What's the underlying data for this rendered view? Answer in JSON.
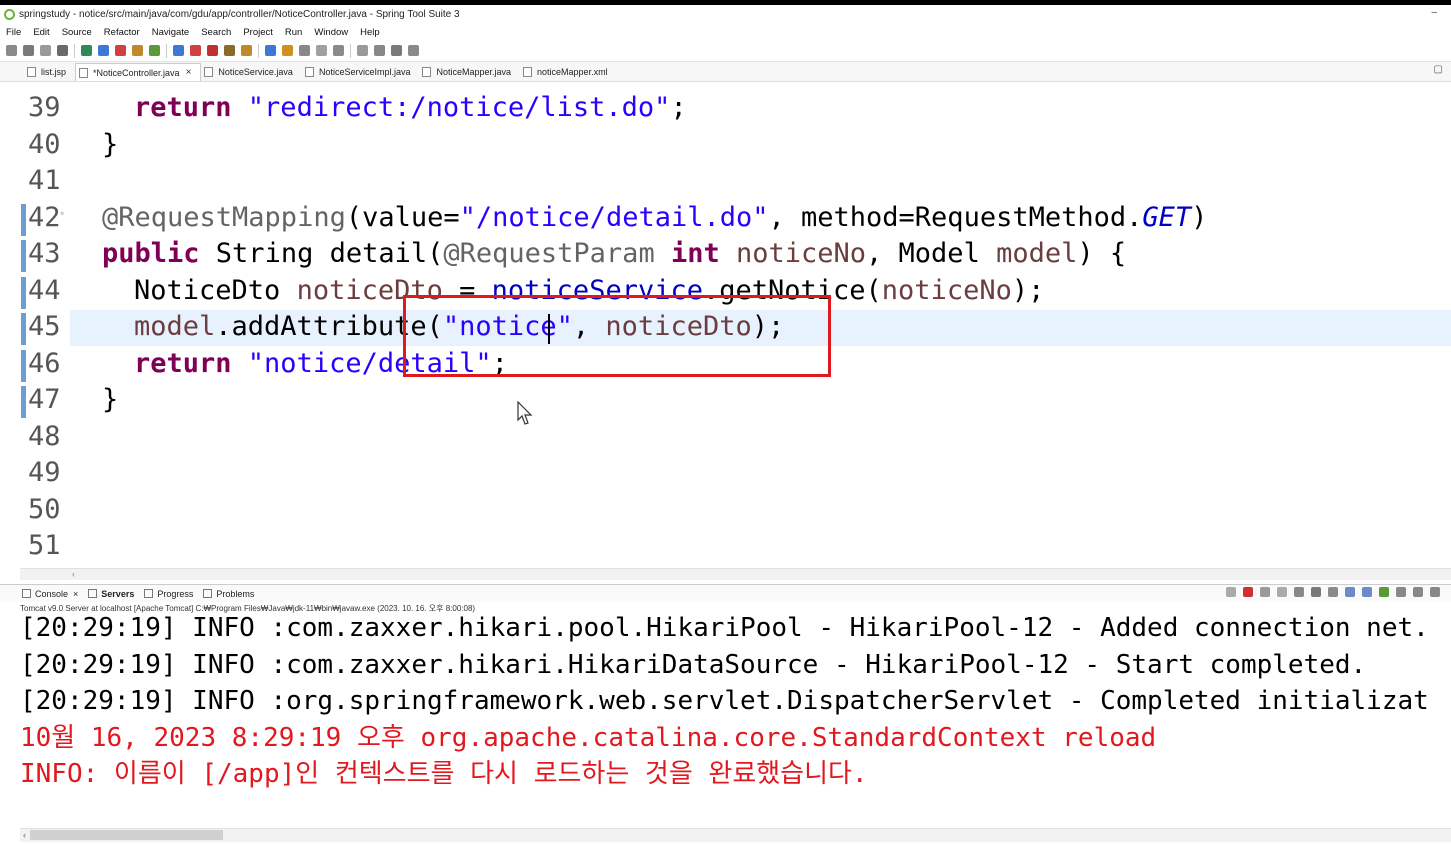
{
  "window": {
    "title": "springstudy - notice/src/main/java/com/gdu/app/controller/NoticeController.java - Spring Tool Suite 3"
  },
  "menu": [
    "File",
    "Edit",
    "Source",
    "Refactor",
    "Navigate",
    "Search",
    "Project",
    "Run",
    "Window",
    "Help"
  ],
  "editor_tabs": [
    {
      "label": "list.jsp",
      "active": false
    },
    {
      "label": "*NoticeController.java",
      "active": true,
      "close": "×"
    },
    {
      "label": "NoticeService.java",
      "active": false
    },
    {
      "label": "NoticeServiceImpl.java",
      "active": false
    },
    {
      "label": "NoticeMapper.java",
      "active": false
    },
    {
      "label": "noticeMapper.xml",
      "active": false
    }
  ],
  "code": {
    "line_numbers": [
      "39",
      "40",
      "41",
      "42",
      "43",
      "44",
      "45",
      "46",
      "47",
      "48",
      "49",
      "50",
      "51"
    ],
    "fold_marker": "◦",
    "lines": [
      {
        "n": "39",
        "parts": [
          [
            "kw",
            "return "
          ],
          [
            "str",
            "\"redirect:/notice/list.do\""
          ],
          [
            "",
            ";"
          ]
        ]
      },
      {
        "n": "40",
        "parts": [
          [
            "",
            "}"
          ]
        ]
      },
      {
        "n": "41",
        "parts": []
      },
      {
        "n": "42",
        "parts": [
          [
            "ann",
            "@RequestMapping"
          ],
          [
            "",
            "(value="
          ],
          [
            "str",
            "\"/notice/detail.do\""
          ],
          [
            "",
            ", method=RequestMethod."
          ],
          [
            "ital",
            "GET"
          ],
          [
            "",
            ")"
          ]
        ]
      },
      {
        "n": "43",
        "parts": [
          [
            "kw",
            "public "
          ],
          [
            "",
            "String detail("
          ],
          [
            "ann",
            "@RequestParam "
          ],
          [
            "kw",
            "int "
          ],
          [
            "var",
            "noticeNo"
          ],
          [
            "",
            ", Model "
          ],
          [
            "var",
            "model"
          ],
          [
            "",
            ") {"
          ]
        ]
      },
      {
        "n": "44",
        "parts": [
          [
            "",
            "NoticeDto "
          ],
          [
            "var",
            "noticeDto"
          ],
          [
            "",
            " = "
          ],
          [
            "fld",
            "noticeService"
          ],
          [
            "",
            ".getNotice("
          ],
          [
            "var",
            "noticeNo"
          ],
          [
            "",
            ");"
          ]
        ]
      },
      {
        "n": "45",
        "parts": [
          [
            "var",
            "model"
          ],
          [
            "",
            ".addAttribute("
          ],
          [
            "str",
            "\"notice\""
          ],
          [
            "",
            ", "
          ],
          [
            "var",
            "noticeDto"
          ],
          [
            "",
            ");"
          ]
        ]
      },
      {
        "n": "46",
        "parts": [
          [
            "kw",
            "return "
          ],
          [
            "str",
            "\"notice/detail\""
          ],
          [
            "",
            ";"
          ]
        ]
      },
      {
        "n": "47",
        "parts": [
          [
            "",
            "}"
          ]
        ]
      }
    ]
  },
  "console_tabs": [
    "Console",
    "Servers",
    "Progress",
    "Problems"
  ],
  "console_close": "×",
  "server_line": "Tomcat v9.0 Server at localhost [Apache Tomcat] C:₩Program Files₩Java₩jdk-11₩bin₩javaw.exe  (2023. 10. 16. 오후 8:00:08)",
  "console_lines": [
    {
      "text": "[20:29:19] INFO :com.zaxxer.hikari.pool.HikariPool - HikariPool-12 - Added connection net.",
      "red": false
    },
    {
      "text": "[20:29:19] INFO :com.zaxxer.hikari.HikariDataSource - HikariPool-12 - Start completed.",
      "red": false
    },
    {
      "text": "[20:29:19] INFO :org.springframework.web.servlet.DispatcherServlet - Completed initializat",
      "red": false
    },
    {
      "text": "10월 16, 2023 8:29:19 오후 org.apache.catalina.core.StandardContext reload",
      "red": true
    },
    {
      "text": "INFO: 이름이 [/app]인 컨텍스트를 다시 로드하는 것을 완료했습니다.",
      "red": true
    }
  ],
  "colors": {
    "keyword": "#7f0055",
    "string": "#2a00ff",
    "annotation": "#646464",
    "field": "#0000c0",
    "highlight_box": "#e0191f",
    "error_text": "#e0191f"
  },
  "minimize": "–",
  "tabs_minimize": "▢",
  "scroll_left": "‹"
}
